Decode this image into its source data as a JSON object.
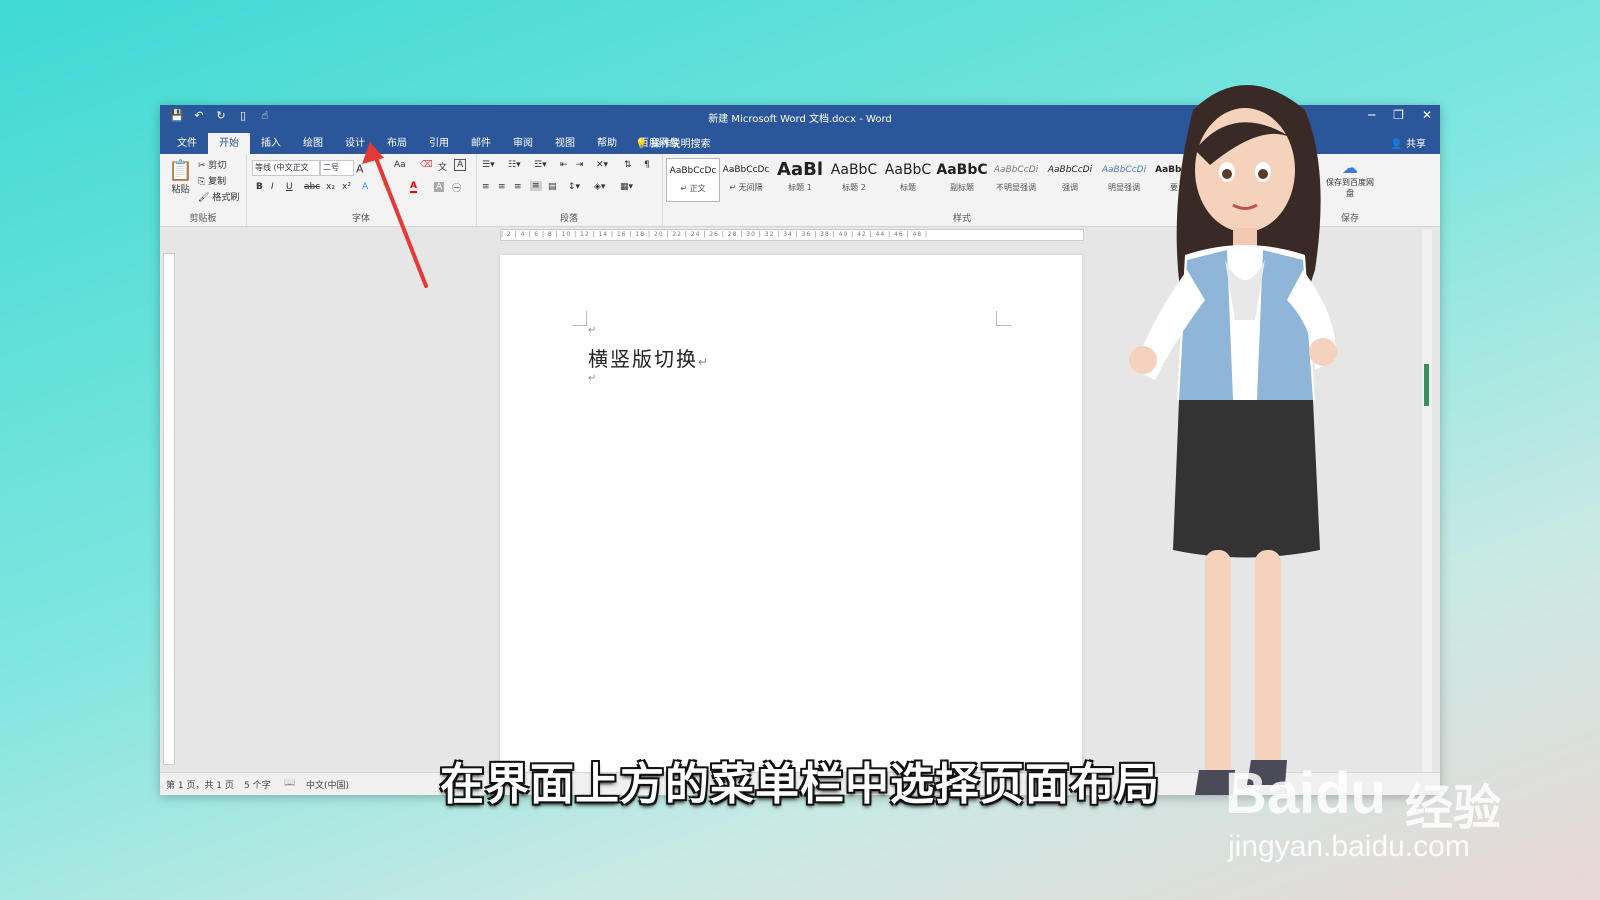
{
  "window": {
    "title": "新建 Microsoft Word 文档.docx - Word",
    "quick_access": [
      "save-icon",
      "undo-icon",
      "redo-icon",
      "print-preview-icon",
      "touch-mode-icon"
    ],
    "controls": {
      "minimize": "─",
      "restore": "❐",
      "close": "✕"
    }
  },
  "menu": {
    "tabs": [
      "文件",
      "开始",
      "插入",
      "绘图",
      "设计",
      "布局",
      "引用",
      "邮件",
      "审阅",
      "视图",
      "帮助",
      "百度网盘"
    ],
    "active_tab": "开始",
    "tell_me": "操作说明搜索",
    "share": "共享"
  },
  "ribbon": {
    "clipboard": {
      "label": "剪贴板",
      "paste": "粘贴",
      "cut": "剪切",
      "copy": "复制",
      "format_painter": "格式刷"
    },
    "font": {
      "label": "字体",
      "font_name": "等线 (中文正文",
      "font_size": "二号",
      "bold": "B",
      "italic": "I",
      "underline": "U",
      "strike": "abc",
      "sub": "x₂",
      "sup": "x²",
      "aa": "Aa",
      "font_color": "A"
    },
    "paragraph": {
      "label": "段落"
    },
    "styles": {
      "label": "样式",
      "items": [
        {
          "preview": "AaBbCcDc",
          "name": "↵ 正文"
        },
        {
          "preview": "AaBbCcDc",
          "name": "↵ 无间隔"
        },
        {
          "preview": "AaBl",
          "name": "标题 1"
        },
        {
          "preview": "AaBbC",
          "name": "标题 2"
        },
        {
          "preview": "AaBbC",
          "name": "标题"
        },
        {
          "preview": "AaBbC",
          "name": "副标题"
        },
        {
          "preview": "AaBbCcDi",
          "name": "不明显强调"
        },
        {
          "preview": "AaBbCcDi",
          "name": "强调"
        },
        {
          "preview": "AaBbCcDi",
          "name": "明显强调"
        },
        {
          "preview": "AaBbCcD",
          "name": "要点"
        }
      ]
    },
    "save": {
      "label": "保存",
      "button": "保存到百度网盘"
    }
  },
  "document": {
    "text": "横竖版切换",
    "para_mark": "↵"
  },
  "status": {
    "page": "第 1 页，共 1 页",
    "words": "5 个字",
    "language": "中文(中国)"
  },
  "subtitle": "在界面上方的菜单栏中选择页面布局",
  "watermark": {
    "logo": "Baidu",
    "brand": "经验",
    "url": "jingyan.baidu.com"
  },
  "colors": {
    "word_blue": "#2b579a",
    "arrow": "#e53935"
  }
}
